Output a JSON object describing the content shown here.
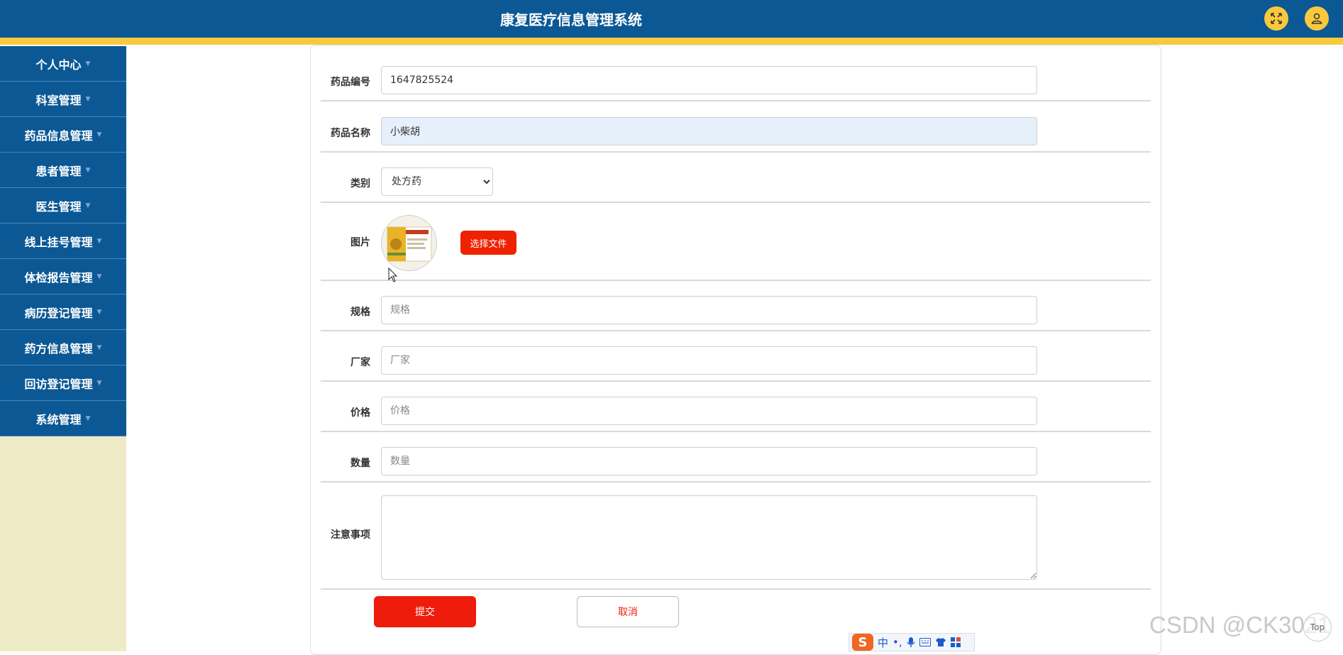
{
  "header": {
    "title": "康复医疗信息管理系统",
    "fullscreen_icon": "fullscreen-icon",
    "user_icon": "user-icon",
    "accent": "#f8c93c",
    "bg": "#0b5895"
  },
  "sidebar": {
    "items": [
      {
        "label": "个人中心"
      },
      {
        "label": "科室管理"
      },
      {
        "label": "药品信息管理"
      },
      {
        "label": "患者管理"
      },
      {
        "label": "医生管理"
      },
      {
        "label": "线上挂号管理"
      },
      {
        "label": "体检报告管理"
      },
      {
        "label": "病历登记管理"
      },
      {
        "label": "药方信息管理"
      },
      {
        "label": "回访登记管理"
      },
      {
        "label": "系统管理"
      }
    ]
  },
  "form": {
    "drug_code": {
      "label": "药品编号",
      "value": "1647825524"
    },
    "drug_name": {
      "label": "药品名称",
      "value": "小柴胡"
    },
    "category": {
      "label": "类别",
      "selected": "处方药"
    },
    "image": {
      "label": "图片",
      "button": "选择文件"
    },
    "spec": {
      "label": "规格",
      "placeholder": "规格"
    },
    "manufacturer": {
      "label": "厂家",
      "placeholder": "厂家"
    },
    "price": {
      "label": "价格",
      "placeholder": "价格"
    },
    "quantity": {
      "label": "数量",
      "placeholder": "数量"
    },
    "notes": {
      "label": "注意事项"
    },
    "submit": "提交",
    "cancel": "取消"
  },
  "ime": {
    "logo": "S",
    "mode": "中"
  },
  "watermark": "CSDN @CK3021",
  "top_button": "Top"
}
